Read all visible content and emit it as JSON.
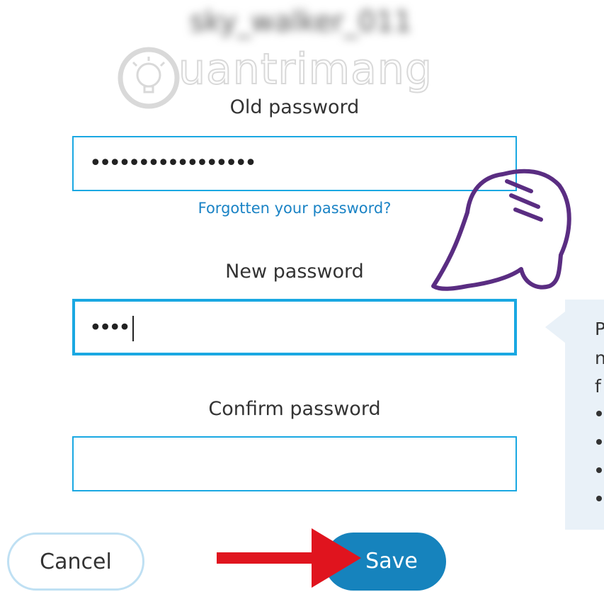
{
  "username": "sky_walker_011",
  "watermark": {
    "text": "uantrimang",
    "icon": "lightbulb-icon"
  },
  "old_password": {
    "label": "Old password",
    "value": "•••••••••••••••••"
  },
  "forgot_link": "Forgotten your password?",
  "new_password": {
    "label": "New password",
    "value": "••••"
  },
  "confirm_password": {
    "label": "Confirm password",
    "value": ""
  },
  "tooltip": {
    "lines": [
      "P",
      "n",
      "f"
    ],
    "bullet_count": 4
  },
  "buttons": {
    "cancel": "Cancel",
    "save": "Save"
  },
  "colors": {
    "accent": "#1aa8e2",
    "save_bg": "#1683bd",
    "link": "#1a83c5",
    "arrow": "#e0141e",
    "hand": "#5a2d82"
  }
}
